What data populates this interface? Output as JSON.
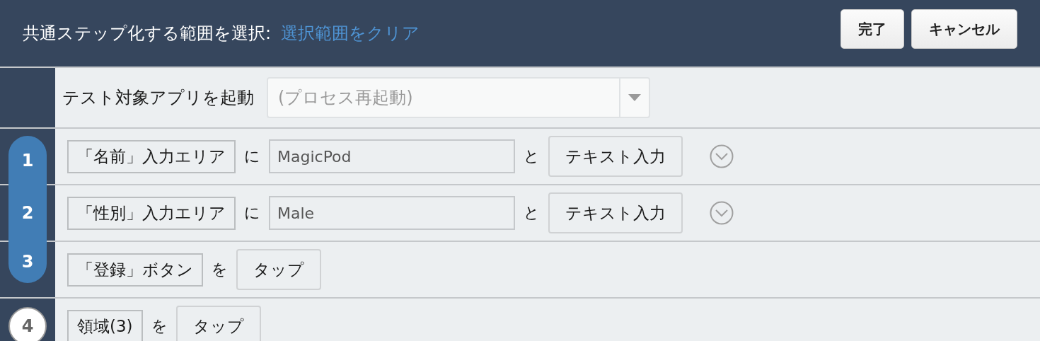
{
  "header": {
    "title": "共通ステップ化する範囲を選択:",
    "clear_link": "選択範囲をクリア",
    "buttons": [
      "完了",
      "キャンセル"
    ]
  },
  "launch_step": {
    "label": "テスト対象アプリを起動",
    "select": {
      "placeholder": "(プロセス再起動)"
    }
  },
  "steps": [
    {
      "number": "1",
      "selected": true,
      "parts": [
        {
          "kind": "element",
          "text": "「名前」入力エリア"
        },
        {
          "kind": "particle",
          "text": "に"
        },
        {
          "kind": "value",
          "text": "MagicPod"
        },
        {
          "kind": "particle",
          "text": "と"
        },
        {
          "kind": "action",
          "text": "テキスト入力"
        },
        {
          "kind": "options"
        }
      ]
    },
    {
      "number": "2",
      "selected": true,
      "parts": [
        {
          "kind": "element",
          "text": "「性別」入力エリア"
        },
        {
          "kind": "particle",
          "text": "に"
        },
        {
          "kind": "value",
          "text": "Male"
        },
        {
          "kind": "particle",
          "text": "と"
        },
        {
          "kind": "action",
          "text": "テキスト入力"
        },
        {
          "kind": "options"
        }
      ]
    },
    {
      "number": "3",
      "selected": true,
      "parts": [
        {
          "kind": "element",
          "text": "「登録」ボタン"
        },
        {
          "kind": "particle",
          "text": "を"
        },
        {
          "kind": "action",
          "text": "タップ"
        }
      ]
    },
    {
      "number": "4",
      "selected": false,
      "parts": [
        {
          "kind": "element",
          "text": "領域(3)"
        },
        {
          "kind": "particle",
          "text": "を"
        },
        {
          "kind": "action",
          "text": "タップ"
        }
      ]
    }
  ]
}
